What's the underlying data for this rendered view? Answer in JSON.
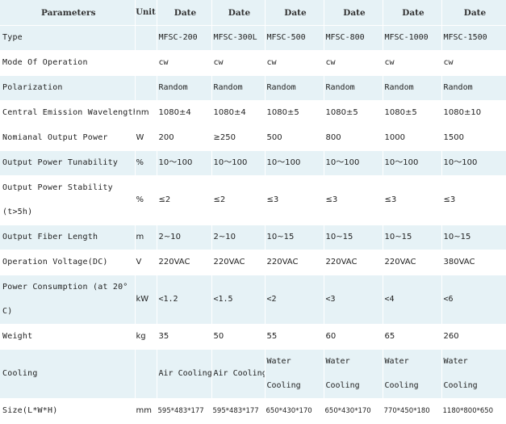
{
  "header": {
    "parameters": "Parameters",
    "unit": "Unit",
    "columns": [
      "Date",
      "Date",
      "Date",
      "Date",
      "Date",
      "Date"
    ]
  },
  "rows": [
    {
      "param": "Type",
      "unit": "",
      "values": [
        "MFSC-200",
        "MFSC-300L",
        "MFSC-500",
        "MFSC-800",
        "MFSC-1000",
        "MFSC-1500"
      ]
    },
    {
      "param": "Mode Of Operation",
      "unit": "",
      "values": [
        "cw",
        "cw",
        "cw",
        "cw",
        "cw",
        "cw"
      ]
    },
    {
      "param": "Polarization",
      "unit": "",
      "values": [
        "Random",
        "Random",
        "Random",
        "Random",
        "Random",
        "Random"
      ]
    },
    {
      "param": "Central Emission Wavelength",
      "unit": "nm",
      "values": [
        "1080±4",
        "1080±4",
        "1080±5",
        "1080±5",
        "1080±5",
        "1080±10"
      ]
    },
    {
      "param": "Nomianal Output Power",
      "unit": "W",
      "values": [
        "200",
        "≥250",
        "500",
        "800",
        "1000",
        "1500"
      ]
    },
    {
      "param": "Output Power Tunability",
      "unit": "%",
      "values": [
        "10～100",
        "10～100",
        "10～100",
        "10～100",
        "10～100",
        "10～100"
      ]
    },
    {
      "param": "Output Power Stability (t>5h)",
      "unit": "%",
      "values": [
        "≤2",
        "≤2",
        "≤3",
        "≤3",
        "≤3",
        "≤3"
      ]
    },
    {
      "param": "Output Fiber Length",
      "unit": "m",
      "values": [
        "2~10",
        "2~10",
        "10~15",
        "10~15",
        "10~15",
        "10~15"
      ]
    },
    {
      "param": "Operation Voltage(DC)",
      "unit": "V",
      "values": [
        "220VAC",
        "220VAC",
        "220VAC",
        "220VAC",
        "220VAC",
        "380VAC"
      ]
    },
    {
      "param": "Power Consumption (at 20° C)",
      "unit": "kW",
      "values": [
        "<1.2",
        "<1.5",
        "<2",
        "<3",
        "<4",
        "<6"
      ]
    },
    {
      "param": "Weight",
      "unit": "kg",
      "values": [
        "35",
        "50",
        "55",
        "60",
        "65",
        "260"
      ]
    },
    {
      "param": "Cooling",
      "unit": "",
      "values": [
        "Air Cooling",
        "Air Cooling",
        "Water Cooling",
        "Water Cooling",
        "Water Cooling",
        "Water Cooling"
      ]
    },
    {
      "param": "Size(L*W*H)",
      "unit": "mm",
      "values": [
        "595*483*177",
        "595*483*177",
        "650*430*170",
        "650*430*170",
        "770*450*180",
        "1180*800*650"
      ]
    }
  ]
}
